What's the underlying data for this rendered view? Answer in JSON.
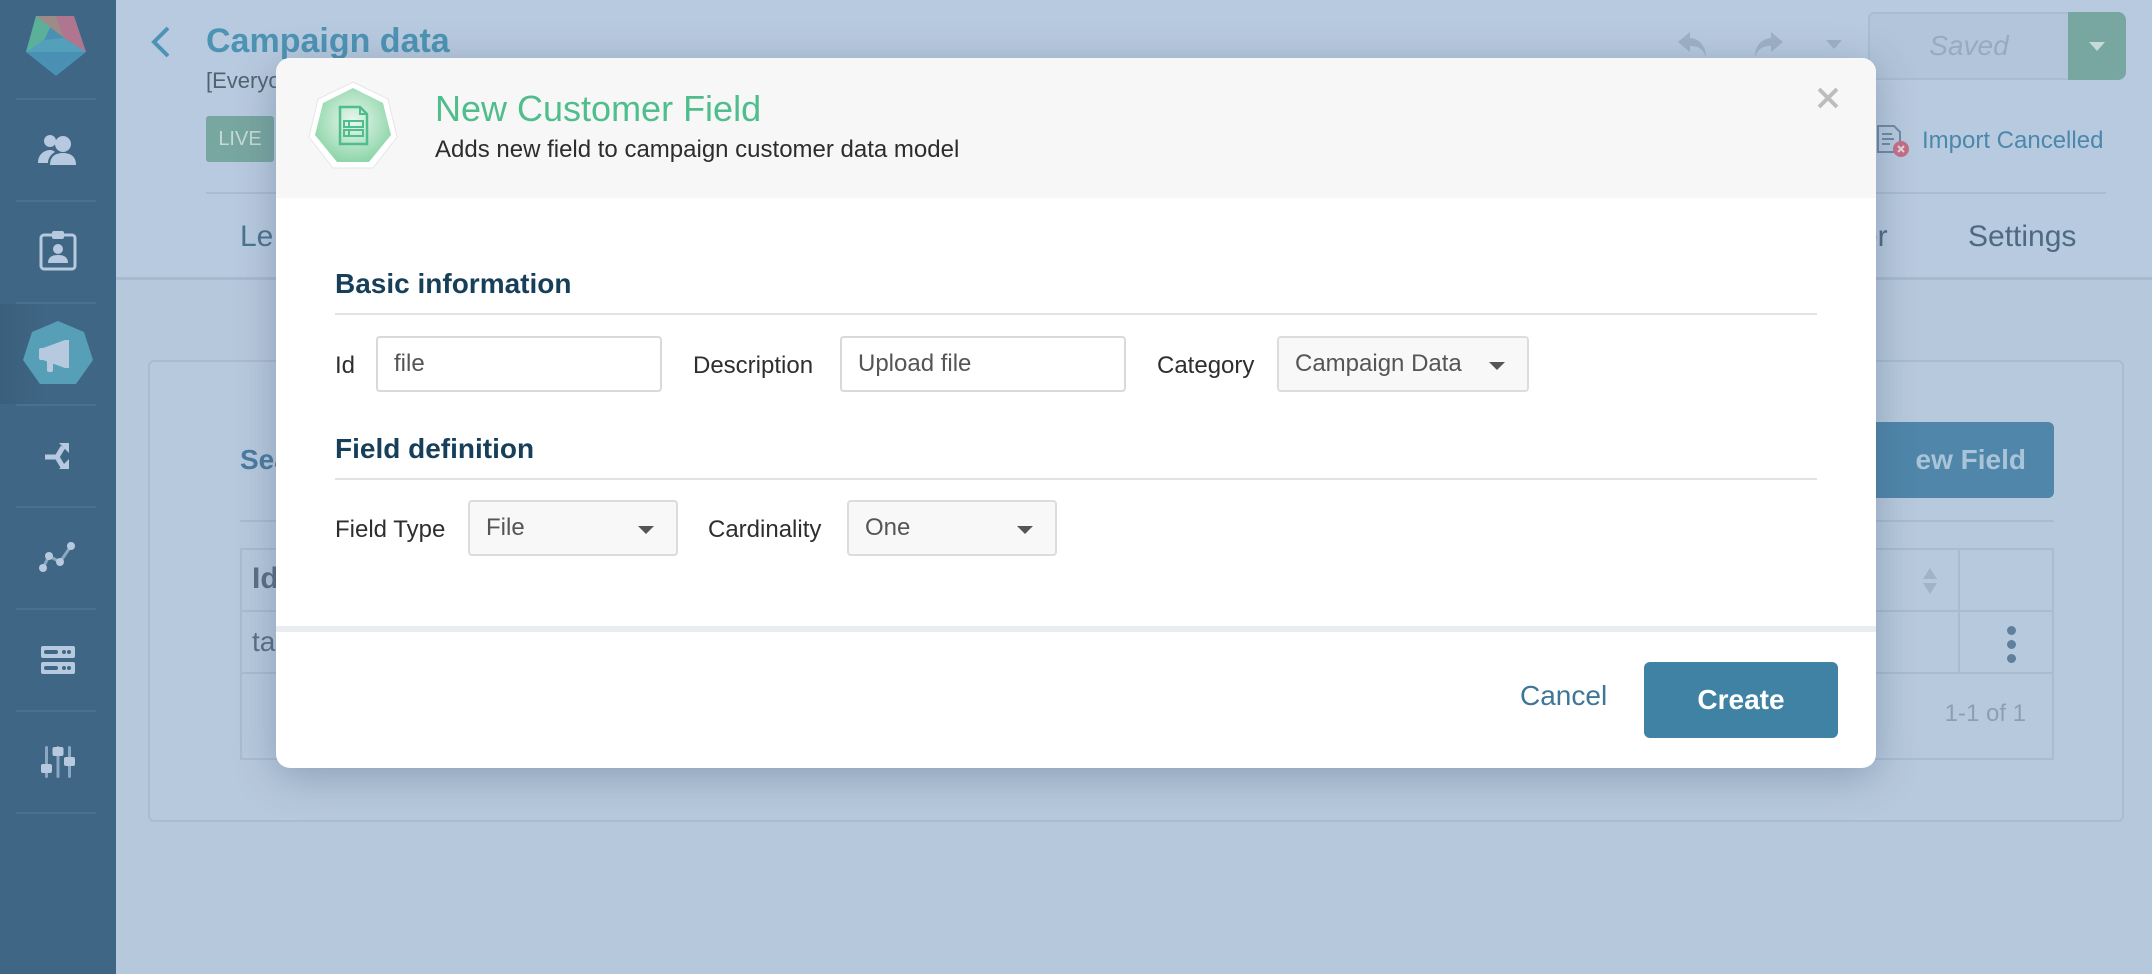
{
  "sidebar": {
    "logo": "app-logo",
    "items": [
      {
        "name": "people",
        "icon": "users-icon",
        "active": false
      },
      {
        "name": "contacts",
        "icon": "id-badge-icon",
        "active": false
      },
      {
        "name": "campaigns",
        "icon": "megaphone-icon",
        "active": true
      },
      {
        "name": "flows",
        "icon": "branch-icon",
        "active": false
      },
      {
        "name": "analytics",
        "icon": "line-chart-icon",
        "active": false
      },
      {
        "name": "data",
        "icon": "server-icon",
        "active": false
      },
      {
        "name": "settings",
        "icon": "sliders-icon",
        "active": false
      }
    ]
  },
  "header": {
    "title": "Campaign data",
    "subtitle": "[Everyo",
    "badge": "LIVE",
    "saved_label": "Saved",
    "import_status": "Import Cancelled",
    "tabs": [
      {
        "label": "Le"
      },
      {
        "label": "er"
      },
      {
        "label": "Settings"
      }
    ]
  },
  "background": {
    "search_label": "Sea",
    "new_field_label": "ew Field",
    "table": {
      "columns": [
        "Id"
      ],
      "rows": [
        [
          "tas"
        ]
      ],
      "pagination": "1-1 of 1"
    }
  },
  "modal": {
    "title": "New Customer Field",
    "subtitle": "Adds new field to campaign customer data model",
    "icon": "document-form-icon",
    "sections": {
      "basic": {
        "title": "Basic information",
        "id_label": "Id",
        "id_value": "file",
        "description_label": "Description",
        "description_value": "Upload file",
        "category_label": "Category",
        "category_value": "Campaign Data"
      },
      "definition": {
        "title": "Field definition",
        "field_type_label": "Field Type",
        "field_type_value": "File",
        "cardinality_label": "Cardinality",
        "cardinality_value": "One"
      }
    },
    "cancel_label": "Cancel",
    "create_label": "Create"
  },
  "colors": {
    "sidebar": "#3f6684",
    "accent_green": "#4fbd8c",
    "primary_button": "#3f82a4",
    "section_title": "#173f5a"
  }
}
